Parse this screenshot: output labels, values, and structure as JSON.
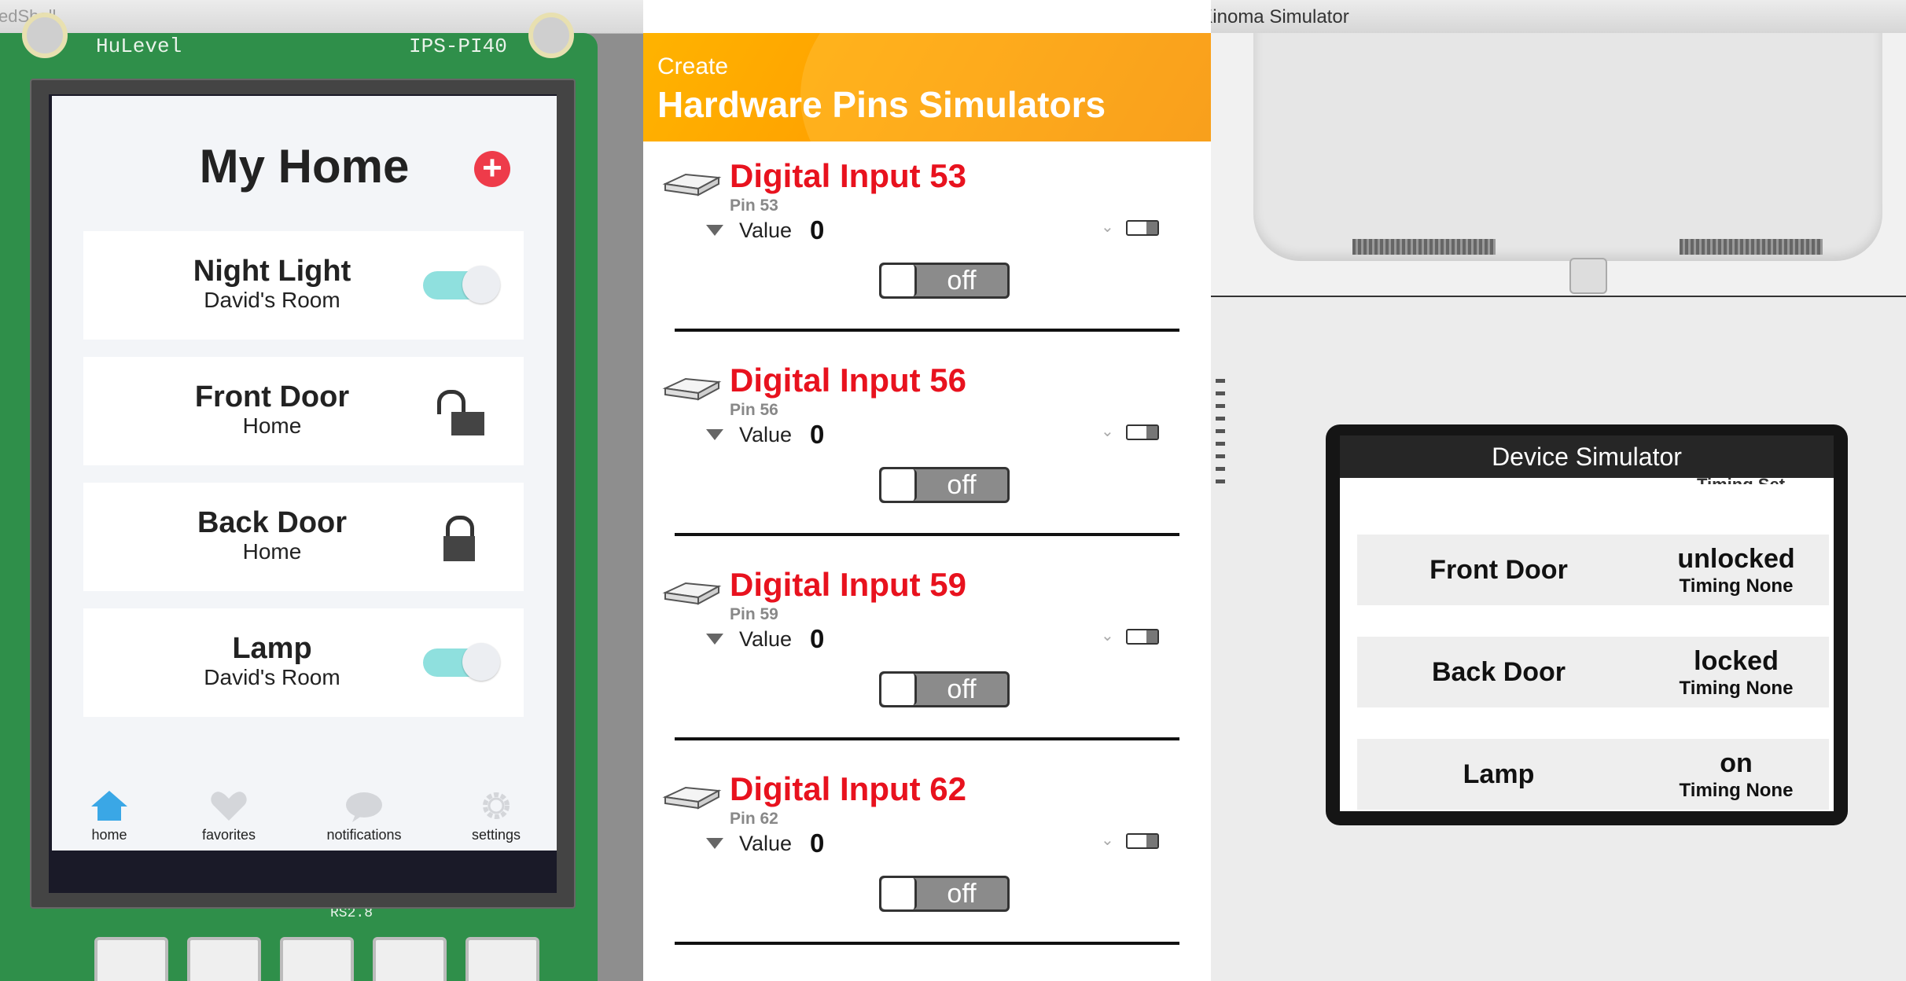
{
  "left_window": {
    "title": "edShell"
  },
  "board": {
    "silk_top_left": "HuLevel",
    "silk_top_right": "IPS-PI40",
    "silk_bottom": "RS2.8"
  },
  "home_app": {
    "title": "My Home",
    "add_icon": "plus-circle-icon",
    "devices": [
      {
        "name": "Night Light",
        "location": "David's Room",
        "control": "toggle",
        "state": "on"
      },
      {
        "name": "Front Door",
        "location": "Home",
        "control": "lock",
        "state": "unlocked"
      },
      {
        "name": "Back Door",
        "location": "Home",
        "control": "lock",
        "state": "locked"
      },
      {
        "name": "Lamp",
        "location": "David's Room",
        "control": "toggle",
        "state": "on"
      }
    ],
    "tabs": [
      {
        "label": "home",
        "icon": "home-icon",
        "active": true
      },
      {
        "label": "favorites",
        "icon": "heart-icon",
        "active": false
      },
      {
        "label": "notifications",
        "icon": "chat-bubble-icon",
        "active": false
      },
      {
        "label": "settings",
        "icon": "gear-icon",
        "active": false
      }
    ]
  },
  "simulator_window": {
    "title": "Kinoma Simulator"
  },
  "pins_panel": {
    "header_small": "Create",
    "header_large": "Hardware Pins Simulators",
    "value_label": "Value",
    "pins": [
      {
        "name": "Digital Input 53",
        "pin": "Pin 53",
        "value": "0",
        "switch": "off"
      },
      {
        "name": "Digital Input 56",
        "pin": "Pin 56",
        "value": "0",
        "switch": "off"
      },
      {
        "name": "Digital Input 59",
        "pin": "Pin 59",
        "value": "0",
        "switch": "off"
      },
      {
        "name": "Digital Input 62",
        "pin": "Pin 62",
        "value": "0",
        "switch": "off"
      }
    ]
  },
  "device_simulator": {
    "title": "Device Simulator",
    "peek_text": "Timing Set",
    "rows": [
      {
        "name": "Front Door",
        "state": "unlocked",
        "timing": "Timing None"
      },
      {
        "name": "Back Door",
        "state": "locked",
        "timing": "Timing None"
      },
      {
        "name": "Lamp",
        "state": "on",
        "timing": "Timing None"
      }
    ]
  },
  "colors": {
    "accent_red": "#e8121e",
    "toggle_on": "#8fe0de",
    "header_orange": "#ffa000",
    "home_blue": "#3aa7e6",
    "add_red": "#ee3b4a"
  }
}
